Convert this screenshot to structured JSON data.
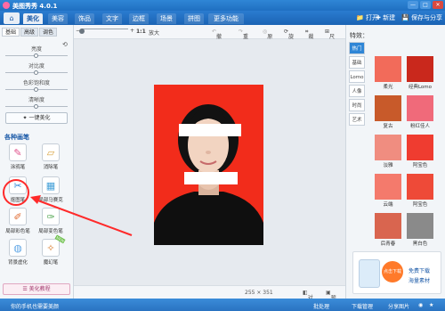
{
  "window": {
    "title": "美图秀秀 4.0.1"
  },
  "tabs": [
    "美化",
    "美容",
    "饰品",
    "文字",
    "边框",
    "场景",
    "拼图",
    "更多功能"
  ],
  "header_right": {
    "open": "打开",
    "new": "新建",
    "save": "保存与分享"
  },
  "toolbar": {
    "zoom_label": "1:1",
    "enlarge": "放大",
    "undo": "撤销",
    "redo": "重做",
    "reset": "原图",
    "rotate": "旋转",
    "crop": "裁剪",
    "size": "尺寸"
  },
  "left_panel": {
    "tabs": [
      "基础",
      "高级",
      "调色"
    ],
    "sliders": [
      {
        "label": "亮度",
        "value": 0.5
      },
      {
        "label": "对比度",
        "value": 0.5
      },
      {
        "label": "色彩饱和度",
        "value": 0.5
      },
      {
        "label": "清晰度",
        "value": 0.5
      }
    ],
    "one_key": "一键美化",
    "section_title": "各种画笔",
    "pens": [
      "涂鸦笔",
      "消除笔",
      "抠图笔",
      "局部马赛克",
      "局部彩色笔",
      "局部变色笔",
      "背景虚化",
      "魔幻笔"
    ],
    "new_badge": "NEW",
    "tutorial": "美化教程"
  },
  "status": {
    "dims": "255 × 351",
    "compare": "对比",
    "preview": "预览"
  },
  "right_panel": {
    "title": "特效：",
    "categories": [
      "热门",
      "基础",
      "Lomo",
      "人像",
      "时尚",
      "艺术"
    ],
    "effects": [
      "柔光",
      "经典Lomo",
      "复古",
      "粉红佳人",
      "淡雅",
      "阿宝色",
      "云端",
      "阿宝色",
      "后青春",
      "黑白色"
    ],
    "ad": {
      "line1": "点击下载",
      "line2": "免费下载",
      "line3": "海量素材"
    }
  },
  "bottom_bar": {
    "left": "你的手机也需要美颜",
    "batch": "批处理",
    "download": "下载管理",
    "share": "分享图片"
  },
  "colors": {
    "accent": "#1f6fc1",
    "photo_bg": "#f22c1b",
    "arrow": "#ff2a2a"
  }
}
